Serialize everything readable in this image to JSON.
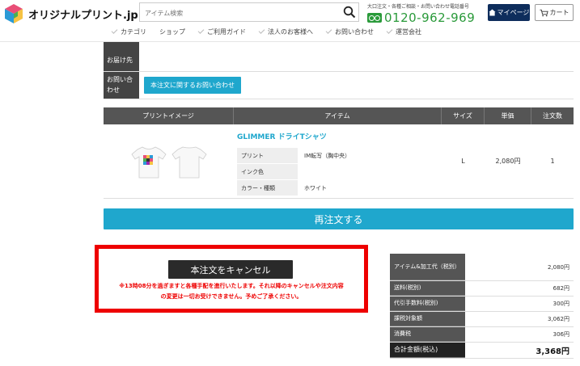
{
  "header": {
    "logo_text": "オリジナルプリント.jp",
    "search_placeholder": "アイテム検索",
    "tel_caption": "大口注文・各種ご相談・お問い合わせ電話番号",
    "tel_number": "0120-962-969",
    "mypage_label": "マイページ",
    "cart_label": "カート"
  },
  "nav": {
    "items": [
      {
        "label": "カテゴリ"
      },
      {
        "label": "ショップ"
      },
      {
        "label": "ご利用ガイド"
      },
      {
        "label": "法人のお客様へ"
      },
      {
        "label": "お問い合わせ"
      },
      {
        "label": "運営会社"
      }
    ]
  },
  "info": {
    "delivery_label": "お届け先",
    "contact_label": "お問い合わせ",
    "contact_button": "本注文に関するお問い合わせ"
  },
  "items": {
    "headers": [
      "プリントイメージ",
      "アイテム",
      "サイズ",
      "単価",
      "注文数"
    ],
    "row": {
      "name": "GLIMMER ドライTシャツ",
      "specs": [
        {
          "k": "プリント",
          "v": "IM転写（胸中央）"
        },
        {
          "k": "インク色",
          "v": ""
        },
        {
          "k": "カラー・種類",
          "v": "ホワイト"
        }
      ],
      "size": "L",
      "price": "2,080円",
      "qty": "1"
    }
  },
  "reorder_label": "再注文する",
  "cancel": {
    "button": "本注文をキャンセル",
    "note_line1": "※13時08分を過ぎますと各種手配を進行いたします。それ以降のキャンセルや注文内容",
    "note_line2": "の変更は一切お受けできません。予めご了承ください。"
  },
  "totals": [
    {
      "k": "アイテム&加工代（税別）",
      "v": "2,080円"
    },
    {
      "k": "送料(税別)",
      "v": "682円"
    },
    {
      "k": "代引手数料(税別)",
      "v": "300円"
    },
    {
      "k": "課税対象額",
      "v": "3,062円"
    },
    {
      "k": "消費税",
      "v": "306円"
    },
    {
      "k": "合計金額(税込)",
      "v": "3,368円"
    }
  ],
  "colors": {
    "accent": "#1fa7cd",
    "warning": "#e00000",
    "navy": "#0e2d5c",
    "tel_green": "#2a9a3a"
  }
}
